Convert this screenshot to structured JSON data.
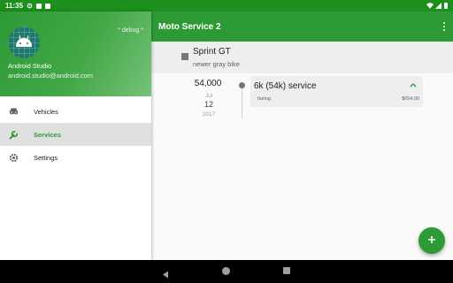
{
  "status_bar": {
    "time": "11:35",
    "icons": [
      "settings-icon",
      "notification-icon",
      "sd-card-icon",
      "wifi-icon",
      "cell-signal-icon",
      "battery-icon"
    ]
  },
  "drawer": {
    "debug_label": "* debug *",
    "user_name": "Android Studio",
    "user_email": "android.studio@android.com",
    "items": [
      {
        "label": "Vehicles",
        "icon": "car-icon",
        "active": false
      },
      {
        "label": "Services",
        "icon": "wrench-icon",
        "active": true
      },
      {
        "label": "Settings",
        "icon": "gear-icon",
        "active": false
      }
    ]
  },
  "app_bar": {
    "title": "Moto Service 2",
    "overflow_icon": "more-vert-icon"
  },
  "vehicle": {
    "name": "Sprint GT",
    "description": "newer gray bike"
  },
  "services": [
    {
      "odometer": "54,000",
      "month": "Jul",
      "day": "12",
      "year": "2017",
      "title": "6k (54k) service",
      "parts": [
        {
          "name": "fairing",
          "cost": "$654.00"
        }
      ]
    }
  ],
  "fab": {
    "icon": "add-icon"
  },
  "colors": {
    "primary": "#2e9a36",
    "status_bar": "#1c8f1c",
    "accent_text": "#2e9a36"
  }
}
